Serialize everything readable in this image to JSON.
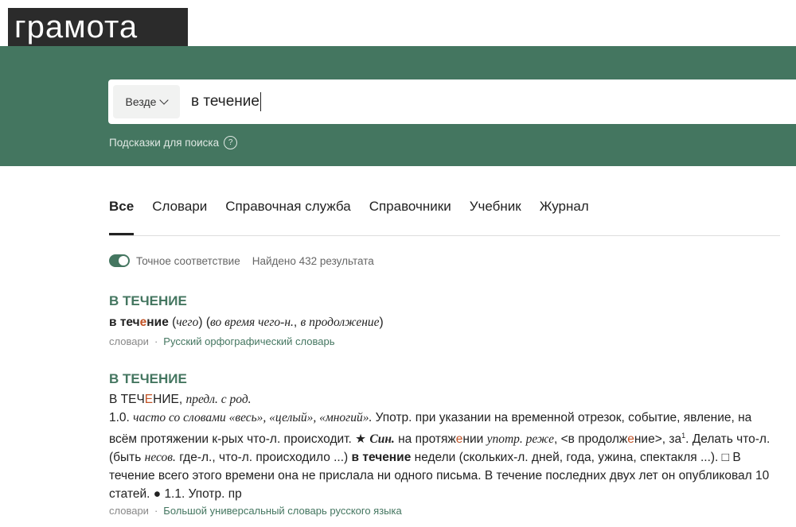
{
  "logo": "грамота",
  "search": {
    "scope_label": "Везде",
    "query": "в течение",
    "hints_label": "Подсказки для поиска",
    "hints_icon": "?"
  },
  "tabs": [
    "Все",
    "Словари",
    "Справочная служба",
    "Справочники",
    "Учебник",
    "Журнал"
  ],
  "filters": {
    "exact_label": "Точное соответствие",
    "found_label": "Найдено 432 результата"
  },
  "results": [
    {
      "title": "В ТЕЧЕНИЕ",
      "category": "словари",
      "source": "Русский орфографический словарь"
    },
    {
      "title": "В ТЕЧЕНИЕ",
      "category": "словари",
      "source": "Большой универсальный словарь русского языка"
    }
  ],
  "colors": {
    "brand_green": "#447660",
    "accent_stress": "#c25326"
  }
}
